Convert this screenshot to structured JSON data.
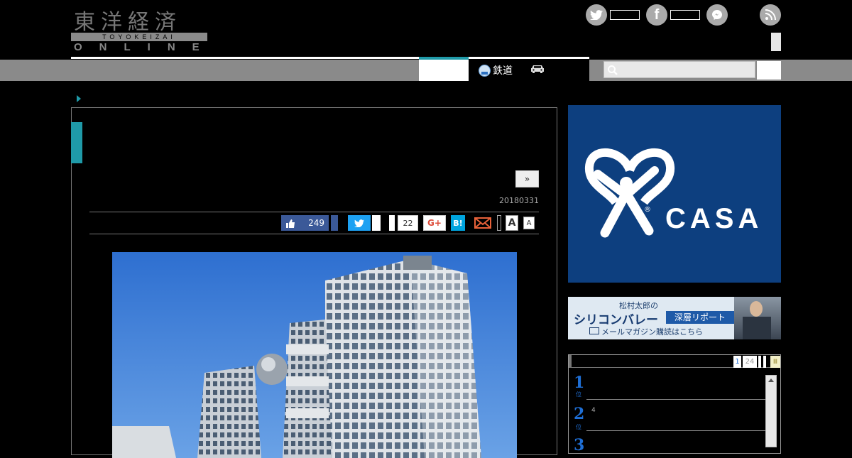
{
  "header": {
    "logo_kanji": "東洋経済",
    "logo_romaji": "TOYOKEIZAI",
    "logo_online": "ONLINE",
    "social_icons": [
      "twitter-icon",
      "facebook-icon",
      "messenger-icon",
      "rss-icon"
    ]
  },
  "nav": {
    "items": [
      {
        "label": "鉄道",
        "icon": "train-icon"
      },
      {
        "label": "",
        "icon": "car-icon"
      }
    ]
  },
  "article": {
    "next_label": "»",
    "date": "20180331",
    "share": {
      "like_count": "249",
      "pocket_count": "22",
      "gplus_label": "G+",
      "hatena_label": "B!",
      "font_large": "A",
      "font_small": "A"
    }
  },
  "sidebar": {
    "casa_brand": "CASA",
    "casa_registered": "®",
    "silicon": {
      "author": "松村太郎の",
      "title": "シリコンバレー",
      "tag": "深層リポート",
      "cta": "メールマガジン購読はこちら"
    },
    "ranking": {
      "pages": [
        "1",
        "24"
      ],
      "items": [
        {
          "rank": "1",
          "sub": "位",
          "note": ""
        },
        {
          "rank": "2",
          "sub": "位",
          "note": "4"
        },
        {
          "rank": "3",
          "sub": "",
          "note": ""
        }
      ]
    }
  },
  "colors": {
    "accent": "#1f9aa8",
    "casa_bg": "#0d3f7f",
    "twitter": "#1da1f2",
    "facebook": "#3b5998"
  }
}
